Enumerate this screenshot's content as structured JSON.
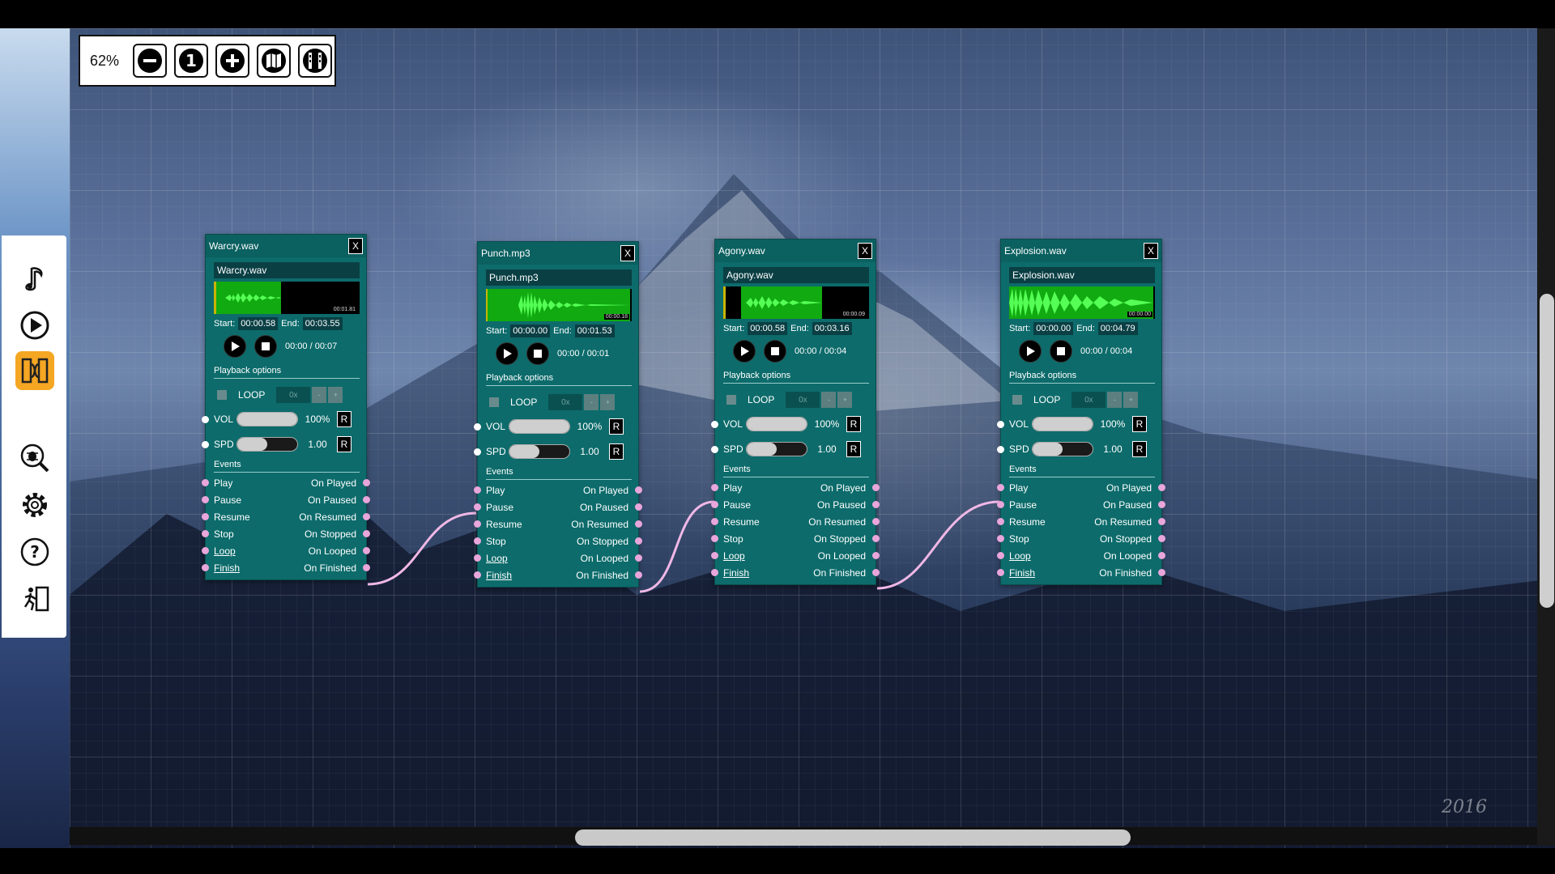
{
  "zoom": {
    "level": "62%",
    "buttons": [
      "zoom-out",
      "zoom-reset",
      "zoom-in",
      "map",
      "film"
    ]
  },
  "sidebar": {
    "tools": [
      "music-note",
      "play",
      "graph",
      "bug",
      "settings",
      "help",
      "exit"
    ],
    "active": "graph"
  },
  "signature": "2016",
  "nodes": [
    {
      "title": "Warcry.wav",
      "file": "Warcry.wav",
      "wave_time": "00:01.81",
      "start": "00:00.58",
      "end": "00:03.55",
      "position": "00:00 / 00:07",
      "section_playback": "Playback options",
      "loop_label": "LOOP",
      "loop_count": "0x",
      "vol_label": "VOL",
      "vol": "100%",
      "spd_label": "SPD",
      "spd": "1.00",
      "reset": "R",
      "section_events": "Events",
      "close": "X",
      "start_label": "Start:",
      "end_label": "End:"
    },
    {
      "title": "Punch.mp3",
      "file": "Punch.mp3",
      "wave_time": "00:00.18",
      "start": "00:00.00",
      "end": "00:01.53",
      "position": "00:00 / 00:01",
      "section_playback": "Playback options",
      "loop_label": "LOOP",
      "loop_count": "0x",
      "vol_label": "VOL",
      "vol": "100%",
      "spd_label": "SPD",
      "spd": "1.00",
      "reset": "R",
      "section_events": "Events",
      "close": "X",
      "start_label": "Start:",
      "end_label": "End:"
    },
    {
      "title": "Agony.wav",
      "file": "Agony.wav",
      "wave_time": "00:00.09",
      "start": "00:00.58",
      "end": "00:03.16",
      "position": "00:00 / 00:04",
      "section_playback": "Playback options",
      "loop_label": "LOOP",
      "loop_count": "0x",
      "vol_label": "VOL",
      "vol": "100%",
      "spd_label": "SPD",
      "spd": "1.00",
      "reset": "R",
      "section_events": "Events",
      "close": "X",
      "start_label": "Start:",
      "end_label": "End:"
    },
    {
      "title": "Explosion.wav",
      "file": "Explosion.wav",
      "wave_time": "00:00.00",
      "start": "00:00.00",
      "end": "00:04.79",
      "position": "00:00 / 00:04",
      "section_playback": "Playback options",
      "loop_label": "LOOP",
      "loop_count": "0x",
      "vol_label": "VOL",
      "vol": "100%",
      "spd_label": "SPD",
      "spd": "1.00",
      "reset": "R",
      "section_events": "Events",
      "close": "X",
      "start_label": "Start:",
      "end_label": "End:"
    }
  ],
  "events": [
    {
      "in": "Play",
      "out": "On Played"
    },
    {
      "in": "Pause",
      "out": "On Paused"
    },
    {
      "in": "Resume",
      "out": "On Resumed"
    },
    {
      "in": "Stop",
      "out": "On Stopped"
    },
    {
      "in": "Loop",
      "out": "On Looped"
    },
    {
      "in": "Finish",
      "out": "On Finished"
    }
  ],
  "colors": {
    "node": "#0d6b6b",
    "accent": "#f5a623",
    "wire": "#f0b8e6",
    "wave": "#22dd22"
  }
}
